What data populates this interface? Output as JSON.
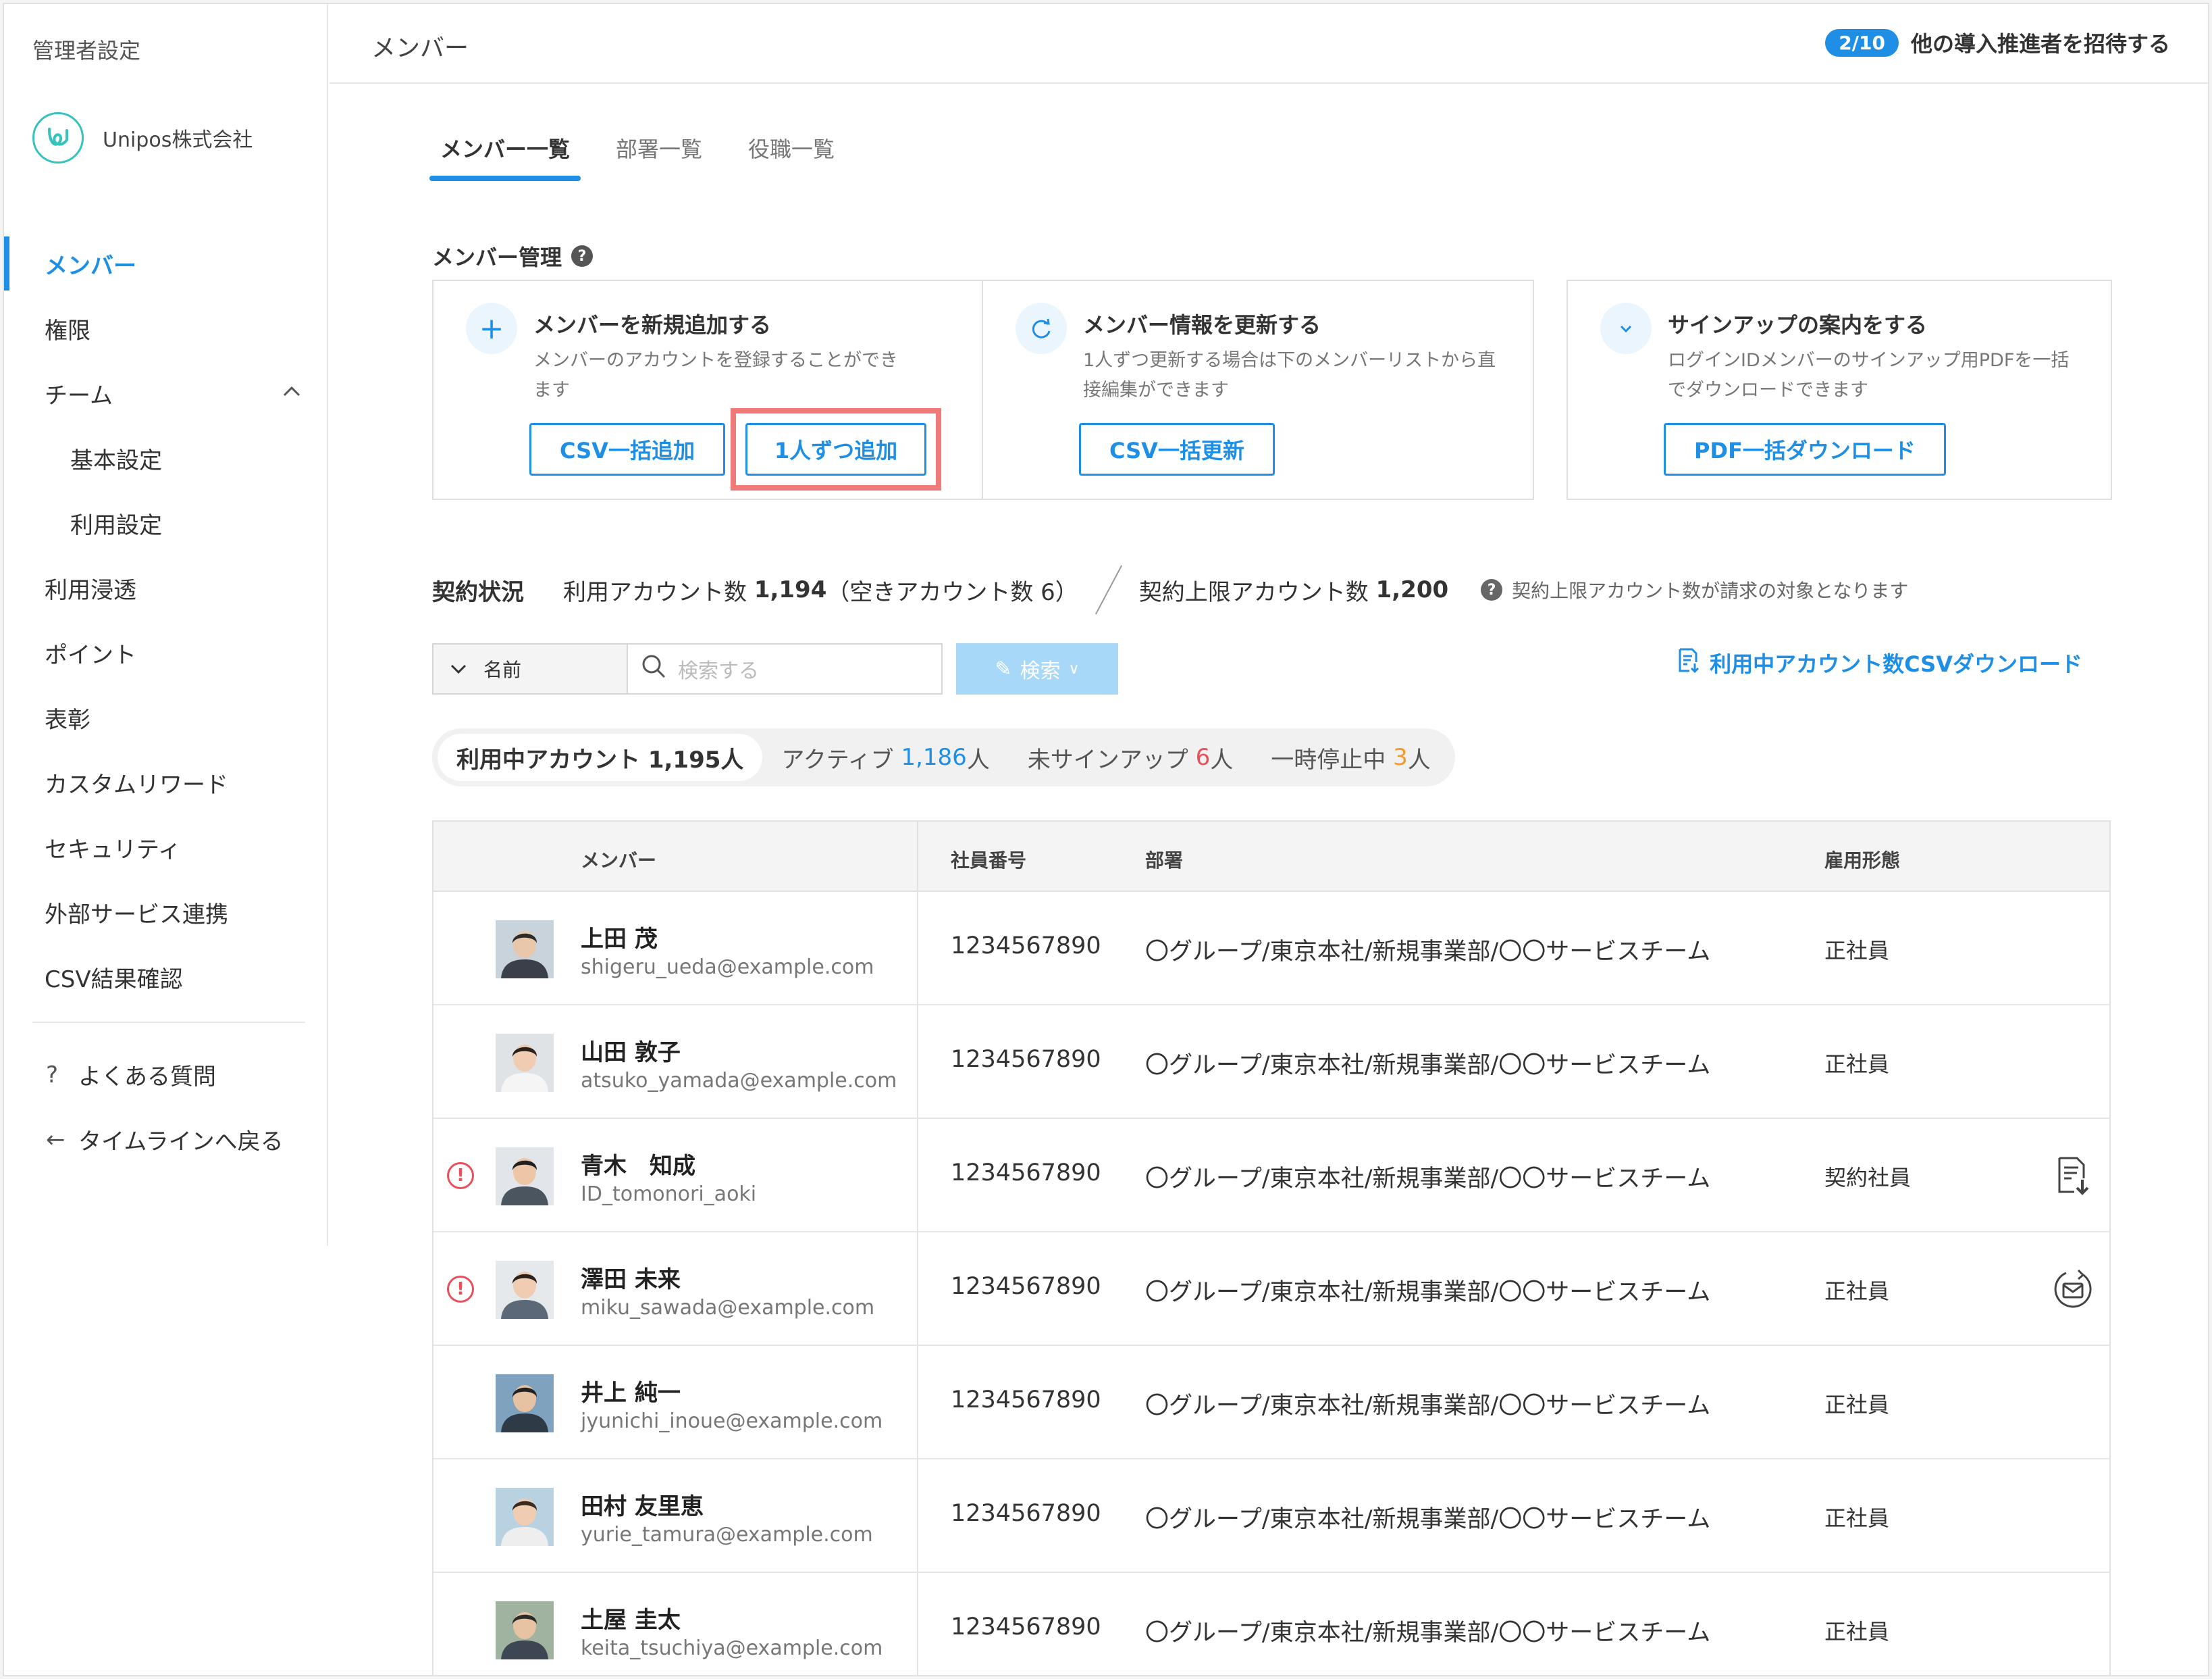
{
  "sidebar": {
    "title": "管理者設定",
    "org_name": "Unipos株式会社",
    "items": [
      {
        "label": "メンバー",
        "active": true,
        "sub": false
      },
      {
        "label": "権限",
        "active": false,
        "sub": false
      },
      {
        "label": "チーム",
        "active": false,
        "sub": false,
        "expandable": true
      },
      {
        "label": "基本設定",
        "active": false,
        "sub": true
      },
      {
        "label": "利用設定",
        "active": false,
        "sub": true
      },
      {
        "label": "利用浸透",
        "active": false,
        "sub": false
      },
      {
        "label": "ポイント",
        "active": false,
        "sub": false
      },
      {
        "label": "表彰",
        "active": false,
        "sub": false
      },
      {
        "label": "カスタムリワード",
        "active": false,
        "sub": false
      },
      {
        "label": "セキュリティ",
        "active": false,
        "sub": false
      },
      {
        "label": "外部サービス連携",
        "active": false,
        "sub": false
      },
      {
        "label": "CSV結果確認",
        "active": false,
        "sub": false
      }
    ],
    "faq": "よくある質問",
    "back": "タイムラインへ戻る"
  },
  "header": {
    "title": "メンバー",
    "invite_count": "2/10",
    "invite_label": "他の導入推進者を招待する"
  },
  "tabs": [
    "メンバー一覧",
    "部署一覧",
    "役職一覧"
  ],
  "management": {
    "title": "メンバー管理",
    "cards": [
      {
        "icon": "plus-icon",
        "title": "メンバーを新規追加する",
        "desc": "メンバーのアカウントを登録することができます",
        "buttons": [
          "CSV一括追加",
          "1人ずつ追加"
        ]
      },
      {
        "icon": "refresh-icon",
        "title": "メンバー情報を更新する",
        "desc": "1人ずつ更新する場合は下のメンバーリストから直接編集ができます",
        "buttons": [
          "CSV一括更新"
        ]
      },
      {
        "icon": "check-icon",
        "title": "サインアップの案内をする",
        "desc": "ログインIDメンバーのサインアップ用PDFを一括でダウンロードできます",
        "buttons": [
          "PDF一括ダウンロード"
        ]
      }
    ]
  },
  "contract": {
    "label": "契約状況",
    "used_label": "利用アカウント数",
    "used_value": "1,194",
    "empty_text": "（空きアカウント数 6）",
    "limit_label": "契約上限アカウント数",
    "limit_value": "1,200",
    "note": "契約上限アカウント数が請求の対象となります"
  },
  "search": {
    "field": "名前",
    "placeholder": "検索する",
    "button": "検索",
    "csv_download": "利用中アカウント数CSVダウンロード"
  },
  "filters": {
    "active_label": "利用中アカウント",
    "active_count": "1,195人",
    "f2_label": "アクティブ",
    "f2_num": "1,186",
    "f3_label": "未サインアップ",
    "f3_num": "6",
    "f4_label": "一時停止中",
    "f4_num": "3",
    "unit": "人"
  },
  "table": {
    "headers": [
      "メンバー",
      "社員番号",
      "部署",
      "雇用形態"
    ],
    "rows": [
      {
        "name": "上田 茂",
        "email": "shigeru_ueda@example.com",
        "emp_no": "1234567890",
        "dept": "〇グループ/東京本社/新規事業部/〇〇サービスチーム",
        "type": "正社員",
        "warning": false,
        "action": ""
      },
      {
        "name": "山田 敦子",
        "email": "atsuko_yamada@example.com",
        "emp_no": "1234567890",
        "dept": "〇グループ/東京本社/新規事業部/〇〇サービスチーム",
        "type": "正社員",
        "warning": false,
        "action": ""
      },
      {
        "name": "青木　知成",
        "email": "ID_tomonori_aoki",
        "emp_no": "1234567890",
        "dept": "〇グループ/東京本社/新規事業部/〇〇サービスチーム",
        "type": "契約社員",
        "warning": true,
        "action": "document-download-icon"
      },
      {
        "name": "澤田 未来",
        "email": "miku_sawada@example.com",
        "emp_no": "1234567890",
        "dept": "〇グループ/東京本社/新規事業部/〇〇サービスチーム",
        "type": "正社員",
        "warning": true,
        "action": "resend-mail-icon"
      },
      {
        "name": "井上 純一",
        "email": "jyunichi_inoue@example.com",
        "emp_no": "1234567890",
        "dept": "〇グループ/東京本社/新規事業部/〇〇サービスチーム",
        "type": "正社員",
        "warning": false,
        "action": ""
      },
      {
        "name": "田村 友里恵",
        "email": "yurie_tamura@example.com",
        "emp_no": "1234567890",
        "dept": "〇グループ/東京本社/新規事業部/〇〇サービスチーム",
        "type": "正社員",
        "warning": false,
        "action": ""
      },
      {
        "name": "土屋 圭太",
        "email": "keita_tsuchiya@example.com",
        "emp_no": "1234567890",
        "dept": "〇グループ/東京本社/新規事業部/〇〇サービスチーム",
        "type": "正社員",
        "warning": false,
        "action": ""
      }
    ]
  },
  "colors": {
    "accent": "#1f8fe6",
    "warning": "#e8505b",
    "highlight": "#f07a7a",
    "orange": "#f39a2b",
    "logo": "#36c3be"
  }
}
